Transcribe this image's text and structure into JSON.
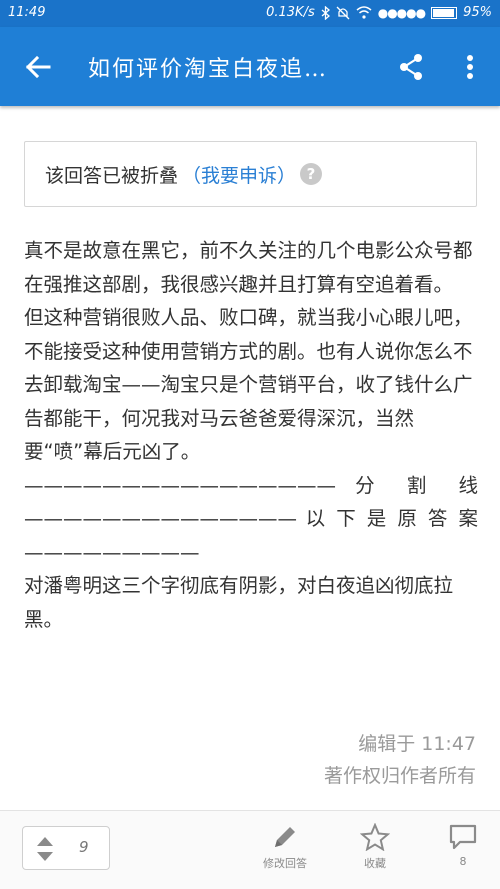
{
  "status_bar": {
    "time": "11:49",
    "network_speed": "0.13K/s",
    "battery": "95%"
  },
  "app_bar": {
    "title": "如何评价淘宝白夜追…"
  },
  "folded_notice": {
    "text": "该回答已被折叠",
    "appeal_link": "（我要申诉）",
    "help_glyph": "?"
  },
  "answer": {
    "paragraphs": [
      "真不是故意在黑它，前不久关注的几个电影公众号都在强推这部剧，我很感兴趣并且打算有空追着看。",
      "但这种营销很败人品、败口碑，就当我小心眼儿吧，不能接受这种使用营销方式的剧。也有人说你怎么不去卸载淘宝——淘宝只是个营销平台，收了钱什么广告都能干，何况我对马云爸爸爱得深沉，当然要“喷”幕后元凶了。"
    ],
    "divider_1": "———————————————— 分 割 线",
    "divider_2": "—————————————— 以 下 是 原 答 案",
    "divider_3": "—————————",
    "last_paragraph": "对潘粤明这三个字彻底有阴影，对白夜追凶彻底拉黑。"
  },
  "meta": {
    "edited": "编辑于 11:47",
    "copyright": "著作权归作者所有"
  },
  "bottom_bar": {
    "vote_count": "9",
    "edit_label": "修改回答",
    "favorite_label": "收藏",
    "comment_count": "8"
  },
  "colors": {
    "app_bar": "#1f7fd6",
    "status_bar": "#1a73c9",
    "link": "#2a7fd4"
  }
}
